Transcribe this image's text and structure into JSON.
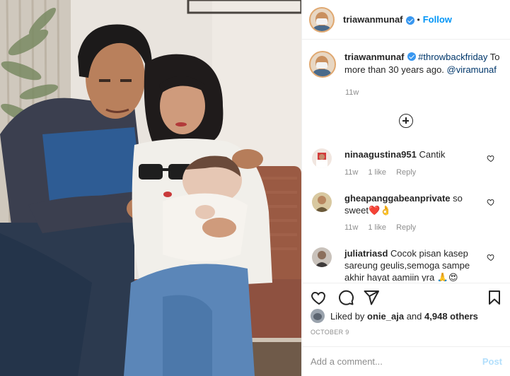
{
  "post": {
    "username": "triawanmunaf",
    "follow_label": "Follow",
    "separator": "•"
  },
  "caption": {
    "username": "triawanmunaf",
    "hashtag": "#throwbackfriday",
    "text": " To more than 30 years ago. ",
    "mention": "@viramunaf",
    "timestamp": "11w"
  },
  "comments": [
    {
      "username": "ninaagustina951",
      "text": "Cantik",
      "time": "11w",
      "likes": "1 like",
      "reply": "Reply"
    },
    {
      "username": "gheapanggabeanprivate",
      "text": "so sweet❤️👌",
      "time": "11w",
      "likes": "1 like",
      "reply": "Reply"
    },
    {
      "username": "juliatriasd",
      "text": "Cocok pisan kasep sareung geulis,semoga sampe akhir hayat aamiin yra 🙏😍",
      "time": "",
      "likes": "",
      "reply": ""
    }
  ],
  "likes": {
    "prefix": "Liked by ",
    "user": "onie_aja",
    "middle": " and ",
    "count": "4,948 others"
  },
  "date": "OCTOBER 9",
  "add_comment": {
    "placeholder": "Add a comment...",
    "post_label": "Post"
  },
  "icons": {
    "like": "heart-icon",
    "comment": "comment-bubble-icon",
    "share": "paper-plane-icon",
    "save": "bookmark-icon",
    "load_more": "plus-circle-icon",
    "verified": "verified-badge-icon"
  },
  "colors": {
    "link_blue": "#0095f6",
    "verified_blue": "#3897f0",
    "muted": "#8e8e8e",
    "post_disabled": "#b2dffc",
    "text": "#262626"
  }
}
